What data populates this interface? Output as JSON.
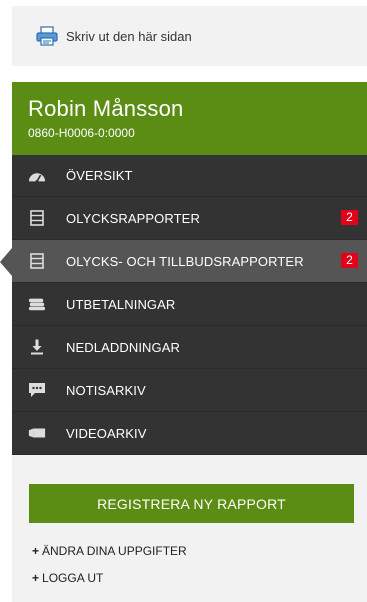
{
  "print": {
    "label": "Skriv ut den här sidan",
    "icon": "printer-icon"
  },
  "user": {
    "name": "Robin Månsson",
    "number": "0860-H0006-0:0000"
  },
  "nav": {
    "items": [
      {
        "label": "ÖVERSIKT",
        "icon": "speedometer-icon",
        "badge": null,
        "active": false
      },
      {
        "label": "OLYCKSRAPPORTER",
        "icon": "document-list-icon",
        "badge": "2",
        "active": false
      },
      {
        "label": "OLYCKS- OCH TILLBUDSRAPPORTER",
        "icon": "document-list-icon",
        "badge": "2",
        "active": true
      },
      {
        "label": "UTBETALNINGAR",
        "icon": "coins-stack-icon",
        "badge": null,
        "active": false
      },
      {
        "label": "NEDLADDNINGAR",
        "icon": "download-icon",
        "badge": null,
        "active": false
      },
      {
        "label": "NOTISARKIV",
        "icon": "chat-bubble-icon",
        "badge": null,
        "active": false
      },
      {
        "label": "VIDEOARKIV",
        "icon": "video-camera-icon",
        "badge": null,
        "active": false
      }
    ]
  },
  "actions": {
    "register_label": "REGISTRERA NY RAPPORT",
    "edit_label": "ÄNDRA DINA UPPGIFTER",
    "logout_label": "LOGGA UT",
    "plus": "+"
  },
  "colors": {
    "brand_green": "#5b8c14",
    "nav_bg": "#333333",
    "nav_active": "#555555",
    "badge_red": "#e3001b",
    "panel_bg": "#f2f2f2"
  }
}
